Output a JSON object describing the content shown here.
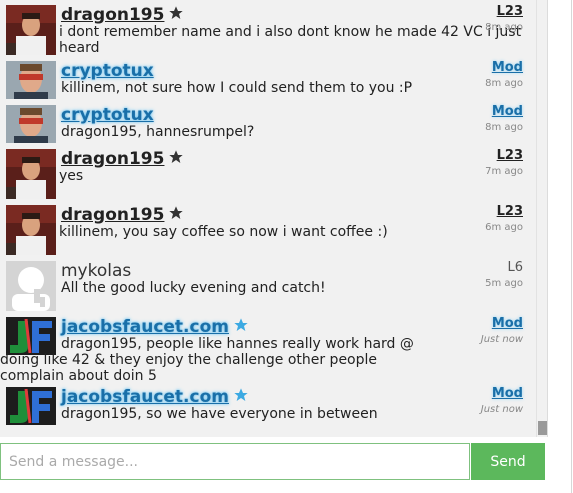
{
  "messages": [
    {
      "user": "dragon195",
      "role": "user",
      "starred": true,
      "level": "L23",
      "time": "8m ago",
      "text": "i dont remember name and i also dont know he made 42 VC i just heard",
      "avatar": "photo-avatar"
    },
    {
      "user": "cryptotux",
      "role": "mod",
      "starred": false,
      "level": "Mod",
      "time": "8m ago",
      "text": "killinem, not sure how I could send them to you :P",
      "avatar": "photo-avatar-glasses"
    },
    {
      "user": "cryptotux",
      "role": "mod",
      "starred": false,
      "level": "Mod",
      "time": "8m ago",
      "text": "dragon195, hannesrumpel?",
      "avatar": "photo-avatar-glasses"
    },
    {
      "user": "dragon195",
      "role": "user",
      "starred": true,
      "level": "L23",
      "time": "7m ago",
      "text": "yes",
      "avatar": "photo-avatar"
    },
    {
      "user": "dragon195",
      "role": "user",
      "starred": true,
      "level": "L23",
      "time": "6m ago",
      "text": "killinem, you say coffee so now i want coffee :)",
      "avatar": "photo-avatar"
    },
    {
      "user": "mykolas",
      "role": "plain",
      "starred": false,
      "level": "L6",
      "time": "5m ago",
      "text": "All the good lucky evening and catch!",
      "avatar": "default-avatar"
    },
    {
      "user": "jacobsfaucet.com",
      "role": "mod",
      "starred": true,
      "level": "Mod",
      "time": "Just now",
      "text": "dragon195, people like hannes really work hard @ doing like 42 & they enjoy the challenge other people complain about doin 5",
      "avatar": "jf-logo-avatar"
    },
    {
      "user": "jacobsfaucet.com",
      "role": "mod",
      "starred": true,
      "level": "Mod",
      "time": "Just now",
      "text": "dragon195, so we have everyone in between",
      "avatar": "jf-logo-avatar"
    }
  ],
  "composer": {
    "placeholder": "Send a message...",
    "send_label": "Send"
  },
  "colors": {
    "mod_name": "#1a6fa8",
    "mod_glow": "#8fd3f6",
    "send_button": "#5cb85c",
    "input_border": "#7fc17f"
  }
}
